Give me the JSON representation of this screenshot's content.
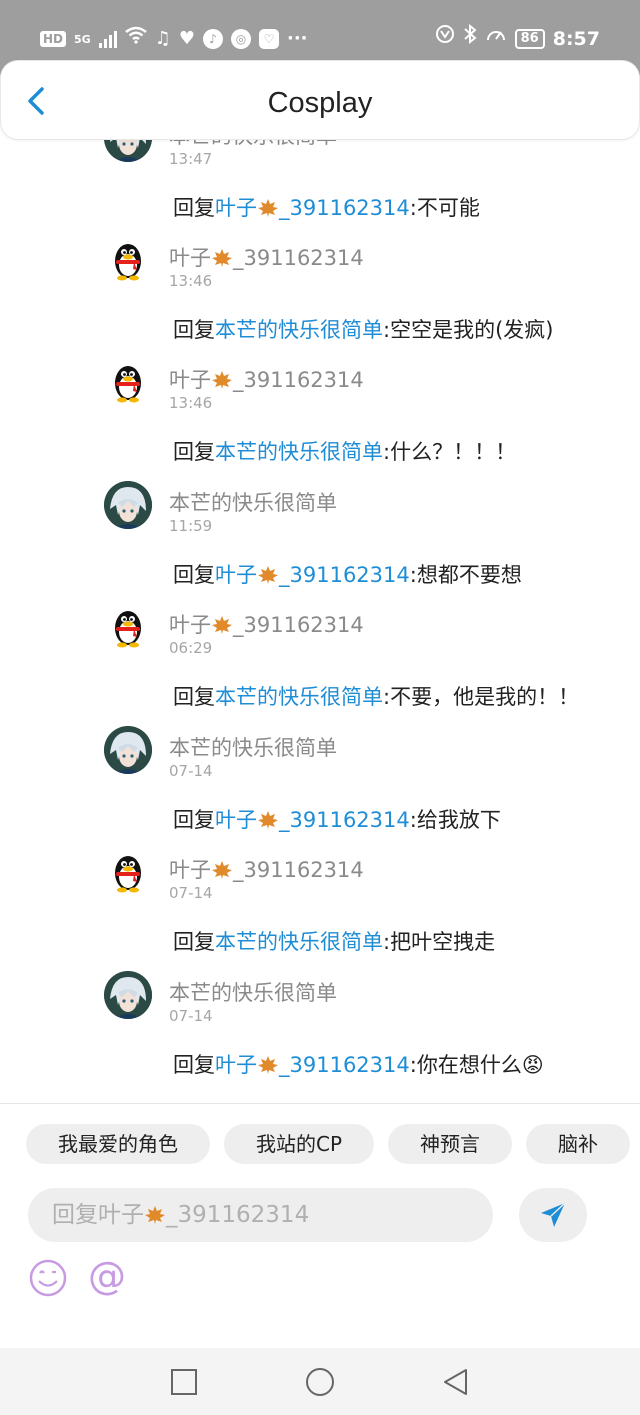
{
  "status_bar": {
    "left_indicators": [
      "HD",
      "5G"
    ],
    "battery": "86",
    "time": "8:57"
  },
  "header": {
    "title": "Cosplay"
  },
  "replies": [
    {
      "avatar": "anime",
      "user": "本芒的快乐很简单",
      "time": "13:47",
      "reply_prefix": "回复",
      "reply_target": "叶子🍁_391162314",
      "separator": ":",
      "content": "不可能"
    },
    {
      "avatar": "qq",
      "user": "叶子🍁_391162314",
      "time": "13:46",
      "reply_prefix": "回复",
      "reply_target": "本芒的快乐很简单",
      "separator": ":",
      "content": "空空是我的(发疯)"
    },
    {
      "avatar": "qq",
      "user": "叶子🍁_391162314",
      "time": "13:46",
      "reply_prefix": "回复",
      "reply_target": "本芒的快乐很简单",
      "separator": ":",
      "content": "什么？！！！"
    },
    {
      "avatar": "anime",
      "user": "本芒的快乐很简单",
      "time": "11:59",
      "reply_prefix": "回复",
      "reply_target": "叶子🍁_391162314",
      "separator": ":",
      "content": "想都不要想"
    },
    {
      "avatar": "qq",
      "user": "叶子🍁_391162314",
      "time": "06:29",
      "reply_prefix": "回复",
      "reply_target": "本芒的快乐很简单",
      "separator": ":",
      "content": "不要，他是我的！！"
    },
    {
      "avatar": "anime",
      "user": "本芒的快乐很简单",
      "time": "07-14",
      "reply_prefix": "回复",
      "reply_target": "叶子🍁_391162314",
      "separator": ":",
      "content": "给我放下"
    },
    {
      "avatar": "qq",
      "user": "叶子🍁_391162314",
      "time": "07-14",
      "reply_prefix": "回复",
      "reply_target": "本芒的快乐很简单",
      "separator": ":",
      "content": "把叶空拽走"
    },
    {
      "avatar": "anime",
      "user": "本芒的快乐很简单",
      "time": "07-14",
      "reply_prefix": "回复",
      "reply_target": "叶子🍁_391162314",
      "separator": ":",
      "content": "你在想什么😡"
    }
  ],
  "quick_tags": [
    "我最爱的角色",
    "我站的CP",
    "神预言",
    "脑补"
  ],
  "input": {
    "placeholder": "回复叶子🍁_391162314"
  },
  "toolbar": {
    "at_label": "@"
  },
  "colors": {
    "status_bar_bg": "#9e9e9e",
    "accent_blue": "#1f8dd6",
    "username_gray": "#8a8a8a",
    "emoji_purple": "#c79be3"
  },
  "icons": {
    "back": "chevron-left-icon",
    "send": "paper-plane-icon",
    "emoji": "smiley-icon",
    "nav": [
      "square-icon",
      "circle-icon",
      "triangle-back-icon"
    ]
  }
}
